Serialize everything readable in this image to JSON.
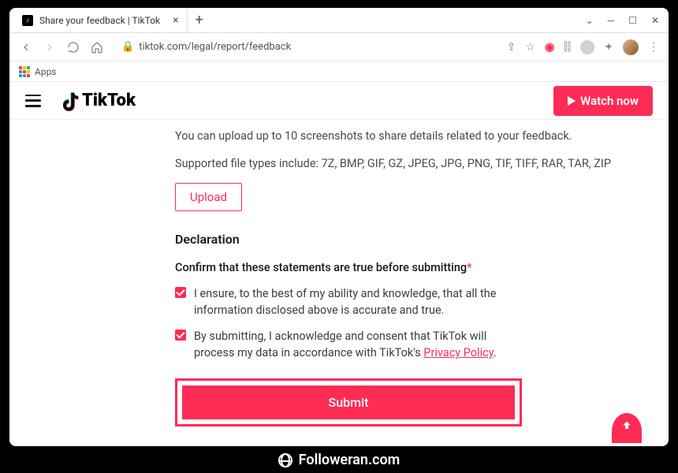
{
  "browser": {
    "tab_title": "Share your feedback | TikTok",
    "url": "tiktok.com/legal/report/feedback",
    "bookmarks_apps": "Apps"
  },
  "header": {
    "logo_text": "TikTok",
    "watch_now": "Watch now"
  },
  "form": {
    "upload_instruction": "You can upload up to 10 screenshots to share details related to your feedback.",
    "supported_types": "Supported file types include: 7Z, BMP, GIF, GZ, JPEG, JPG, PNG, TIF, TIFF, RAR, TAR, ZIP",
    "upload_btn": "Upload",
    "declaration_heading": "Declaration",
    "confirm_intro": "Confirm that these statements are true before submitting",
    "check1": "I ensure, to the best of my ability and knowledge, that all the information disclosed above is accurate and true.",
    "check2_a": "By submitting, I acknowledge and consent that TikTok will process my data in accordance with TikTok's ",
    "check2_link": "Privacy Policy",
    "check2_b": ".",
    "submit": "Submit"
  },
  "footer": {
    "brand": "Followeran.com"
  }
}
